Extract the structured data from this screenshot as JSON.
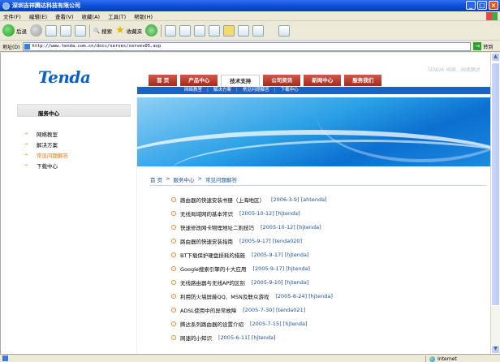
{
  "window": {
    "title": "深圳吉祥腾达科技有限公司"
  },
  "menubar": [
    "文件(F)",
    "编辑(E)",
    "查看(V)",
    "收藏(A)",
    "工具(T)",
    "帮助(H)"
  ],
  "toolbar": {
    "back": "后退",
    "search": "搜索",
    "favorites": "收藏夹"
  },
  "address": {
    "label": "地址(D)",
    "url": "http://www.tenda.com.cn/docc/serves/serves05.asp",
    "go": "转到"
  },
  "site": {
    "logo": "Tenda",
    "slogan": "TENDA 网络，网络腾达",
    "nav": [
      "首 页",
      "产品中心",
      "技术支持",
      "公司资讯",
      "新闻中心",
      "服务我们"
    ],
    "nav_active_index": 2,
    "subnav": [
      "网络教室",
      "解决方案",
      "常见问题解答",
      "下载中心"
    ]
  },
  "sidebar": {
    "title": "服务中心",
    "items": [
      "网络教室",
      "解决方案",
      "常见问题解答",
      "下载中心"
    ],
    "current_index": 2
  },
  "breadcrumb": [
    "首 页",
    ">",
    "服务中心",
    ">",
    "常见问题解答"
  ],
  "articles": [
    {
      "title": "路由器的快速安装书册（上海地区）",
      "meta": "[2006-3-9] [ahtenda]"
    },
    {
      "title": "无线局域网的基本常识",
      "meta": "[2005-10-12] [hjtenda]"
    },
    {
      "title": "快速修改网卡物理地址二则技巧",
      "meta": "[2005-10-12] [hjtenda]"
    },
    {
      "title": "路由器的快速安装指南",
      "meta": "[2005-9-17] [tenda020]"
    },
    {
      "title": "BT下载保护硬盘损耗的措施",
      "meta": "[2005-9-17] [hjtenda]"
    },
    {
      "title": "Google搜索引擎的十大应用",
      "meta": "[2005-9-17] [hjtenda]"
    },
    {
      "title": "无线路由器与无线AP的区别",
      "meta": "[2005-9-10] [hjtenda]"
    },
    {
      "title": "利用防火墙屏蔽QQ、MSN及联众游戏",
      "meta": "[2005-8-24] [hjtenda]"
    },
    {
      "title": "ADSL使用中的异常故障",
      "meta": "[2005-7-30] [tenda021]"
    },
    {
      "title": "腾达系列路由器的设置介绍",
      "meta": "[2005-7-15] [hjtenda]"
    },
    {
      "title": "网速的小知识",
      "meta": "[2005-6-11] [hjtenda]"
    }
  ],
  "status": {
    "zone": "Internet"
  }
}
